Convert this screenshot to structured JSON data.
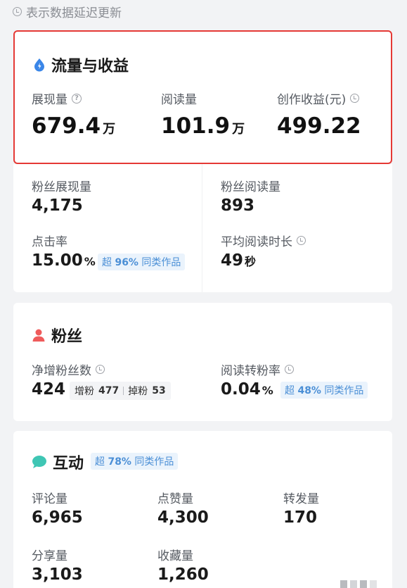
{
  "top_note": "表示数据延迟更新",
  "traffic": {
    "title": "流量与收益",
    "metrics": [
      {
        "label": "展现量",
        "value": "679.4",
        "unit": "万"
      },
      {
        "label": "阅读量",
        "value": "101.9",
        "unit": "万"
      },
      {
        "label": "创作收益(元)",
        "value": "499.22",
        "unit": ""
      }
    ],
    "fan_impressions": {
      "label": "粉丝展现量",
      "value": "4,175"
    },
    "fan_reads": {
      "label": "粉丝阅读量",
      "value": "893"
    },
    "ctr": {
      "label": "点击率",
      "value": "15.00",
      "unit": "%",
      "badge_prefix": "超",
      "badge_pct": "96%",
      "badge_suffix": "同类作品"
    },
    "avg_read_time": {
      "label": "平均阅读时长",
      "value": "49",
      "unit": "秒"
    }
  },
  "fans": {
    "title": "粉丝",
    "net_new": {
      "label": "净增粉丝数",
      "value": "424",
      "gain_label": "增粉",
      "gain": "477",
      "loss_label": "掉粉",
      "loss": "53"
    },
    "conversion": {
      "label": "阅读转粉率",
      "value": "0.04",
      "unit": "%",
      "badge_prefix": "超",
      "badge_pct": "48%",
      "badge_suffix": "同类作品"
    }
  },
  "interaction": {
    "title": "互动",
    "badge_prefix": "超",
    "badge_pct": "78%",
    "badge_suffix": "同类作品",
    "metrics": [
      {
        "label": "评论量",
        "value": "6,965"
      },
      {
        "label": "点赞量",
        "value": "4,300"
      },
      {
        "label": "转发量",
        "value": "170"
      },
      {
        "label": "分享量",
        "value": "3,103"
      },
      {
        "label": "收藏量",
        "value": "1,260"
      }
    ]
  },
  "colors": {
    "highlight_border": "#e53935",
    "badge_text": "#4b8fd6",
    "badge_bg": "#eaf3fc",
    "traffic_icon": "#3a86e8",
    "fans_icon": "#ef5b5b",
    "interaction_icon": "#3fc6b4"
  },
  "icons": {
    "traffic": "traffic-drop-icon",
    "fans": "person-icon",
    "interaction": "chat-bubble-icon",
    "delay": "clock-icon",
    "help": "question-icon"
  }
}
